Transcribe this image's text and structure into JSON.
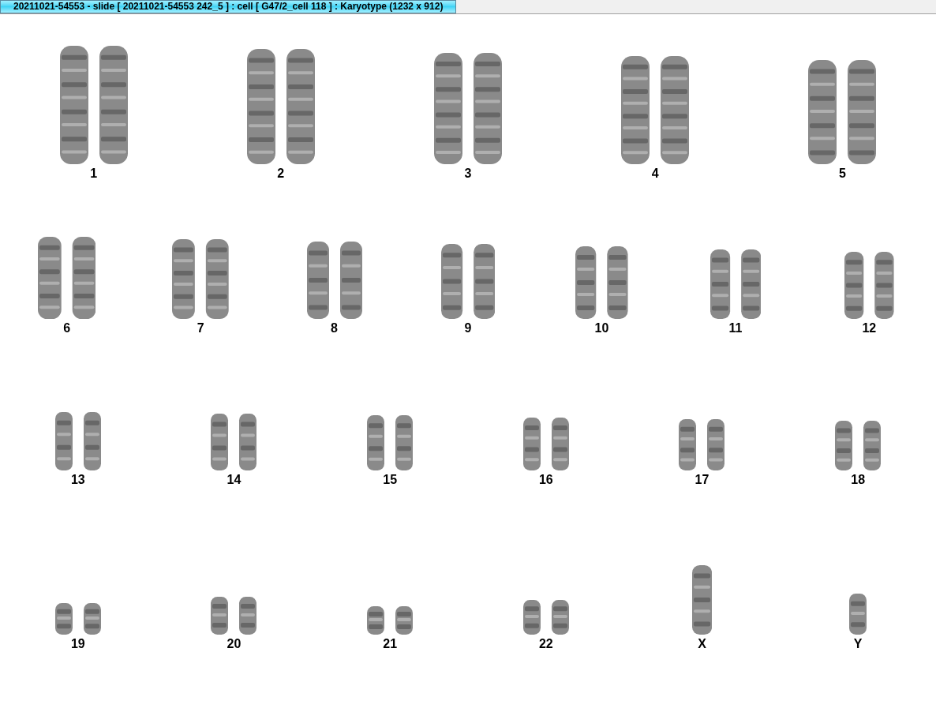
{
  "window": {
    "title": "20211021-54553 - slide [ 20211021-54553 242_5 ] : cell [ G47/2_cell 118 ] : Karyotype  (1232 x 912)"
  },
  "rows": [
    {
      "items": [
        {
          "label": "1",
          "kind": "pair"
        },
        {
          "label": "2",
          "kind": "pair"
        },
        {
          "label": "3",
          "kind": "pair"
        },
        {
          "label": "4",
          "kind": "pair"
        },
        {
          "label": "5",
          "kind": "pair"
        }
      ]
    },
    {
      "items": [
        {
          "label": "6",
          "kind": "pair"
        },
        {
          "label": "7",
          "kind": "pair"
        },
        {
          "label": "8",
          "kind": "pair"
        },
        {
          "label": "9",
          "kind": "pair"
        },
        {
          "label": "10",
          "kind": "pair"
        },
        {
          "label": "11",
          "kind": "pair"
        },
        {
          "label": "12",
          "kind": "pair"
        }
      ]
    },
    {
      "items": [
        {
          "label": "13",
          "kind": "pair"
        },
        {
          "label": "14",
          "kind": "pair"
        },
        {
          "label": "15",
          "kind": "pair"
        },
        {
          "label": "16",
          "kind": "pair"
        },
        {
          "label": "17",
          "kind": "pair"
        },
        {
          "label": "18",
          "kind": "pair"
        }
      ]
    },
    {
      "items": [
        {
          "label": "19",
          "kind": "pair"
        },
        {
          "label": "20",
          "kind": "pair"
        },
        {
          "label": "21",
          "kind": "pair"
        },
        {
          "label": "22",
          "kind": "pair"
        },
        {
          "label": "X",
          "kind": "single"
        },
        {
          "label": "Y",
          "kind": "single"
        }
      ]
    }
  ]
}
